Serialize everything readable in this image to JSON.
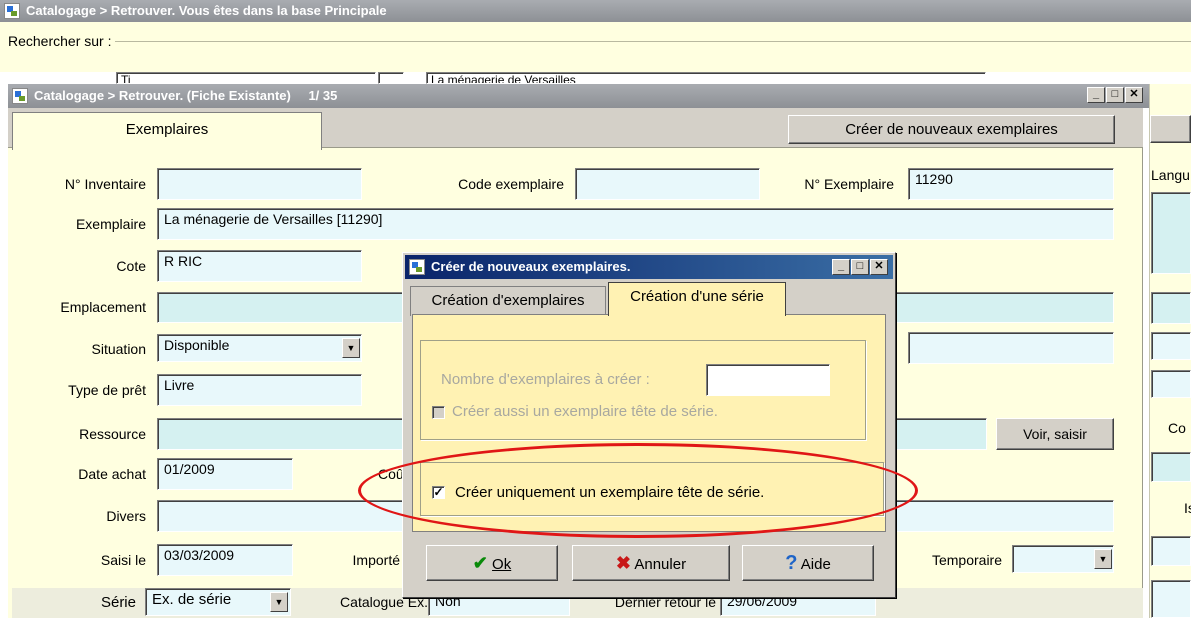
{
  "back_window": {
    "title": "Catalogage > Retrouver. Vous êtes dans la base Principale",
    "search_legend": "Rechercher sur :",
    "partial_field": "Ti",
    "partial_value": "La ménagerie de Versailles"
  },
  "main_window": {
    "title": "Catalogage > Retrouver. (Fiche Existante)",
    "record_counter": "1/ 35",
    "tab_exemplaires": "Exemplaires",
    "create_button": "Créer de nouveaux exemplaires",
    "right_partial_labels": [
      "Langu",
      "Co",
      "Is"
    ],
    "fields": {
      "inventaire_label": "N° Inventaire",
      "inventaire_value": "",
      "code_label": "Code exemplaire",
      "code_value": "",
      "numero_label": "N° Exemplaire",
      "numero_value": "11290",
      "exemplaire_label": "Exemplaire",
      "exemplaire_value": "La ménagerie de Versailles [11290]",
      "cote_label": "Cote",
      "cote_value": "R RIC",
      "emplacement_label": "Emplacement",
      "situation_label": "Situation",
      "situation_value": "Disponible",
      "type_pret_label": "Type de prêt",
      "type_pret_value": "Livre",
      "ressource_label": "Ressource",
      "voir_button": "Voir, saisir",
      "date_achat_label": "Date achat",
      "date_achat_value": "01/2009",
      "cout_partial": "Coû",
      "divers_label": "Divers",
      "saisi_label": "Saisi le",
      "saisi_value": "03/03/2009",
      "importe_label": "Importé",
      "temporaire_label": "Temporaire",
      "serie_label": "Série",
      "serie_value": "Ex. de série",
      "catalogue_label": "Catalogue Ex.",
      "catalogue_value": "Non",
      "dernier_retour_label": "Dernier retour le",
      "dernier_retour_value": "29/06/2009"
    }
  },
  "dialog": {
    "title": "Créer de nouveaux exemplaires.",
    "tab_creation_exemplaires": "Création d'exemplaires",
    "tab_creation_serie": "Création d'une série",
    "nombre_label": "Nombre d'exemplaires à créer :",
    "nombre_value": "",
    "checkbox_tete_aussi": "Créer aussi un exemplaire tête de série.",
    "checkbox_tete_aussi_checked": false,
    "checkbox_tete_uniquement": "Créer uniquement un exemplaire tête de série.",
    "checkbox_tete_uniquement_checked": true,
    "ok_button": "Ok",
    "annuler_button": "Annuler",
    "aide_button": "Aide",
    "highlight_color": "#e01616"
  }
}
